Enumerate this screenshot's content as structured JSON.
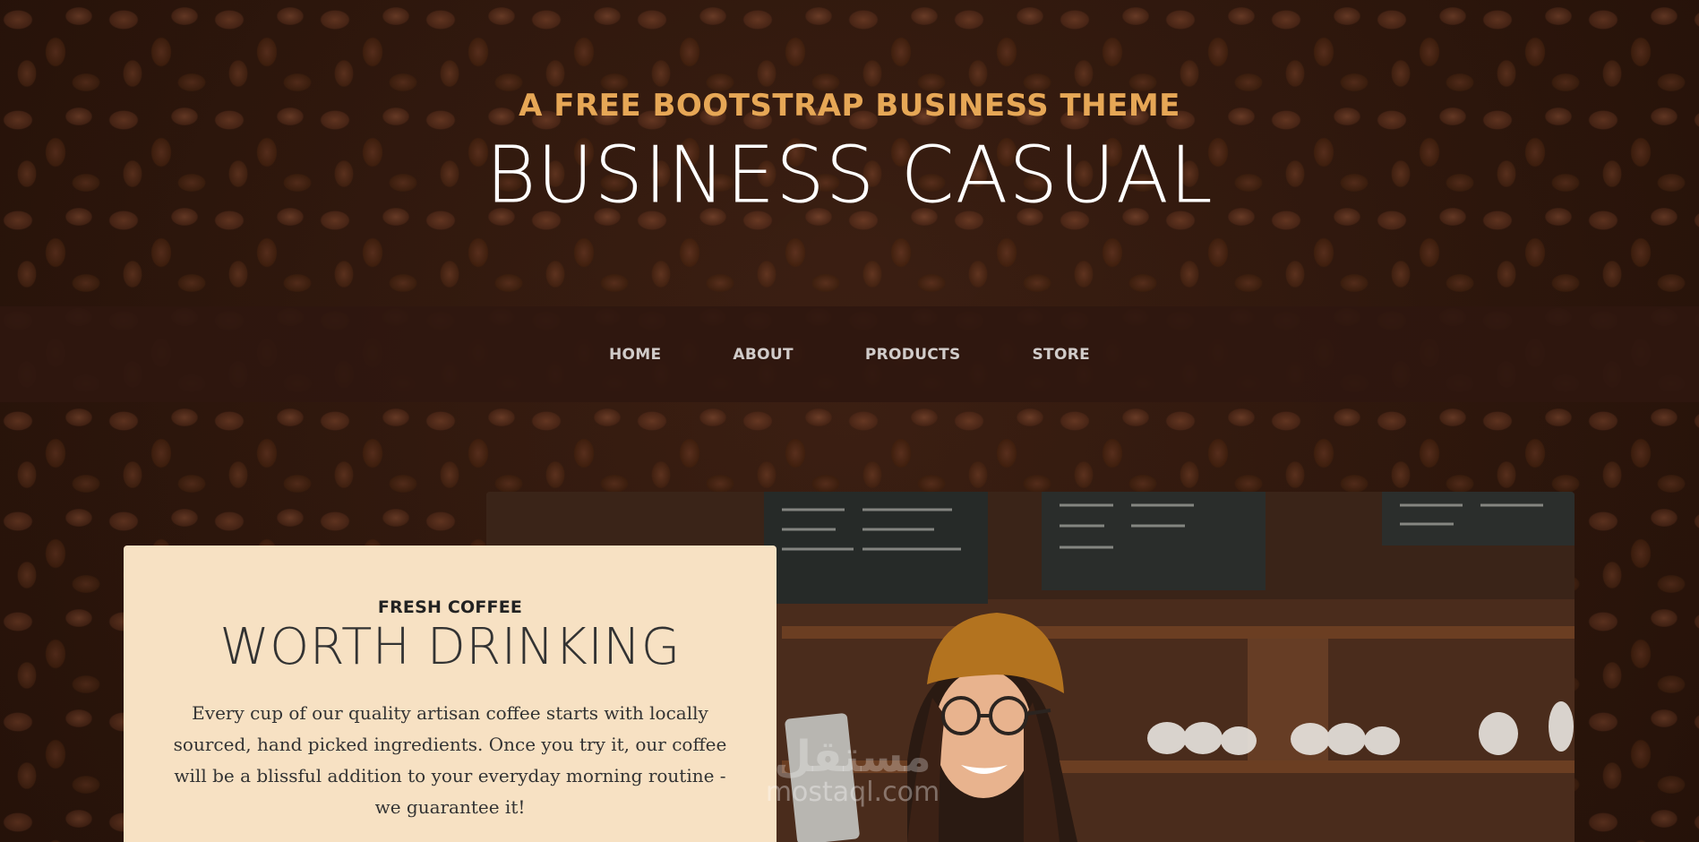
{
  "header": {
    "tagline": "A FREE BOOTSTRAP BUSINESS THEME",
    "title": "BUSINESS CASUAL"
  },
  "nav": {
    "items": [
      {
        "label": "HOME"
      },
      {
        "label": "ABOUT"
      },
      {
        "label": "PRODUCTS"
      },
      {
        "label": "STORE"
      }
    ]
  },
  "intro": {
    "upper": "FRESH COFFEE",
    "lower": "WORTH DRINKING",
    "text": "Every cup of our quality artisan coffee starts with locally sourced, hand picked ingredients. Once you try it, our coffee will be a blissful addition to your everyday morning routine - we guarantee it!"
  },
  "watermark": {
    "logo": "مستقل",
    "text": "mostaql.com"
  },
  "colors": {
    "accent": "#e6a756",
    "nav_bg": "#2f170f",
    "intro_box_bg": "#f7e1c3",
    "background": "#3a1f14"
  }
}
